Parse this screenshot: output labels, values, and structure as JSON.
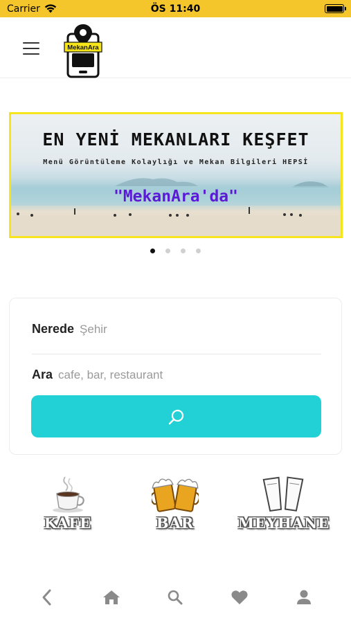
{
  "status_bar": {
    "carrier": "Carrier",
    "time": "ÖS 11:40"
  },
  "header": {
    "logo_text": "MekanAra",
    "menu_icon": "hamburger-menu-icon"
  },
  "banner": {
    "title": "EN YENİ MEKANLARI KEŞFET",
    "subtitle": "Menü Görüntüleme Kolaylığı ve Mekan Bilgileri HEPSİ",
    "brand": "\"MekanAra'da\"",
    "border_color": "#f5e51a",
    "brand_color": "#5b1bd6"
  },
  "carousel": {
    "count": 4,
    "active_index": 0
  },
  "search": {
    "location_label": "Nerede",
    "location_placeholder": "Şehir",
    "query_label": "Ara",
    "query_placeholder": "cafe, bar, restaurant",
    "button_icon": "search-icon",
    "button_color": "#22d1d5"
  },
  "categories": [
    {
      "label": "KAFE",
      "icon": "coffee-cup-icon"
    },
    {
      "label": "BAR",
      "icon": "beer-mugs-icon"
    },
    {
      "label": "MEYHANE",
      "icon": "raki-glasses-icon"
    }
  ],
  "bottom_nav": [
    {
      "icon": "back-chevron-icon"
    },
    {
      "icon": "home-icon"
    },
    {
      "icon": "search-icon"
    },
    {
      "icon": "heart-icon"
    },
    {
      "icon": "profile-icon"
    }
  ],
  "colors": {
    "status_bar": "#f4c62c",
    "nav_icons": "#8a8a8a"
  }
}
